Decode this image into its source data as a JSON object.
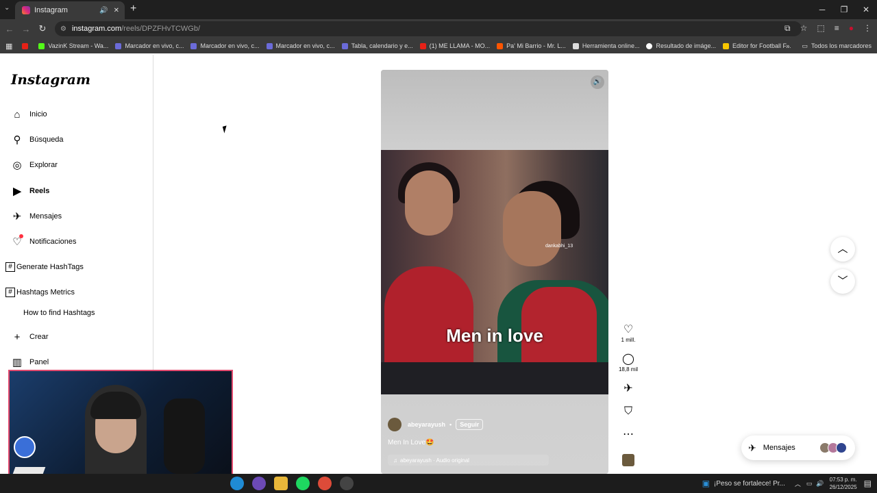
{
  "browser": {
    "tab_title": "Instagram",
    "url_host": "instagram.com",
    "url_path": "/reels/DPZFHvTCWGb/",
    "bookmarks": [
      {
        "label": "",
        "kind": "yt"
      },
      {
        "label": "VazinK Stream - Wa...",
        "kind": "vz"
      },
      {
        "label": "Marcador en vivo, c...",
        "kind": "doc2"
      },
      {
        "label": "Marcador en vivo, c...",
        "kind": "doc2"
      },
      {
        "label": "Marcador en vivo, c...",
        "kind": "doc2"
      },
      {
        "label": "Tabla, calendario y e...",
        "kind": "doc2"
      },
      {
        "label": "(1) ME LLAMA - MO...",
        "kind": "yt"
      },
      {
        "label": "Pa' Mi Barrio - Mr. L...",
        "kind": "so"
      },
      {
        "label": "Herramienta online...",
        "kind": "doc"
      },
      {
        "label": "Resultado de imáge...",
        "kind": "g"
      },
      {
        "label": "Editor for Football F...",
        "kind": "h"
      }
    ],
    "all_bookmarks": "Todos los marcadores"
  },
  "sidebar": {
    "logo": "Instagram",
    "items": [
      {
        "label": "Inicio",
        "icon": "home-icon",
        "glyph": "⌂"
      },
      {
        "label": "Búsqueda",
        "icon": "search-icon",
        "glyph": "⚲"
      },
      {
        "label": "Explorar",
        "icon": "compass-icon",
        "glyph": "◎"
      },
      {
        "label": "Reels",
        "icon": "reels-icon",
        "glyph": "▶"
      },
      {
        "label": "Mensajes",
        "icon": "send-icon",
        "glyph": "✈"
      },
      {
        "label": "Notificaciones",
        "icon": "heart-icon",
        "glyph": "♡"
      }
    ],
    "generate_hashtags": "Generate HashTags",
    "hashtags_metrics": "Hashtags Metrics",
    "how_to_find": "How to find Hashtags",
    "create": "Crear",
    "panel": "Panel"
  },
  "reel": {
    "watermark": "dankabhi_13",
    "overlay_text": "Men in love",
    "author": "abeyarayush",
    "follow": "Seguir",
    "separator": "•",
    "caption": "Men In Love🤩",
    "audio": "abeyarayush · Audio original",
    "likes": "1 mill.",
    "comments": "18,8 mil"
  },
  "messages_pill": {
    "label": "Mensajes"
  },
  "taskbar": {
    "news": "¡Peso se fortalece! Pr...",
    "time": "07:53 p. m.",
    "date": "26/12/2025"
  }
}
